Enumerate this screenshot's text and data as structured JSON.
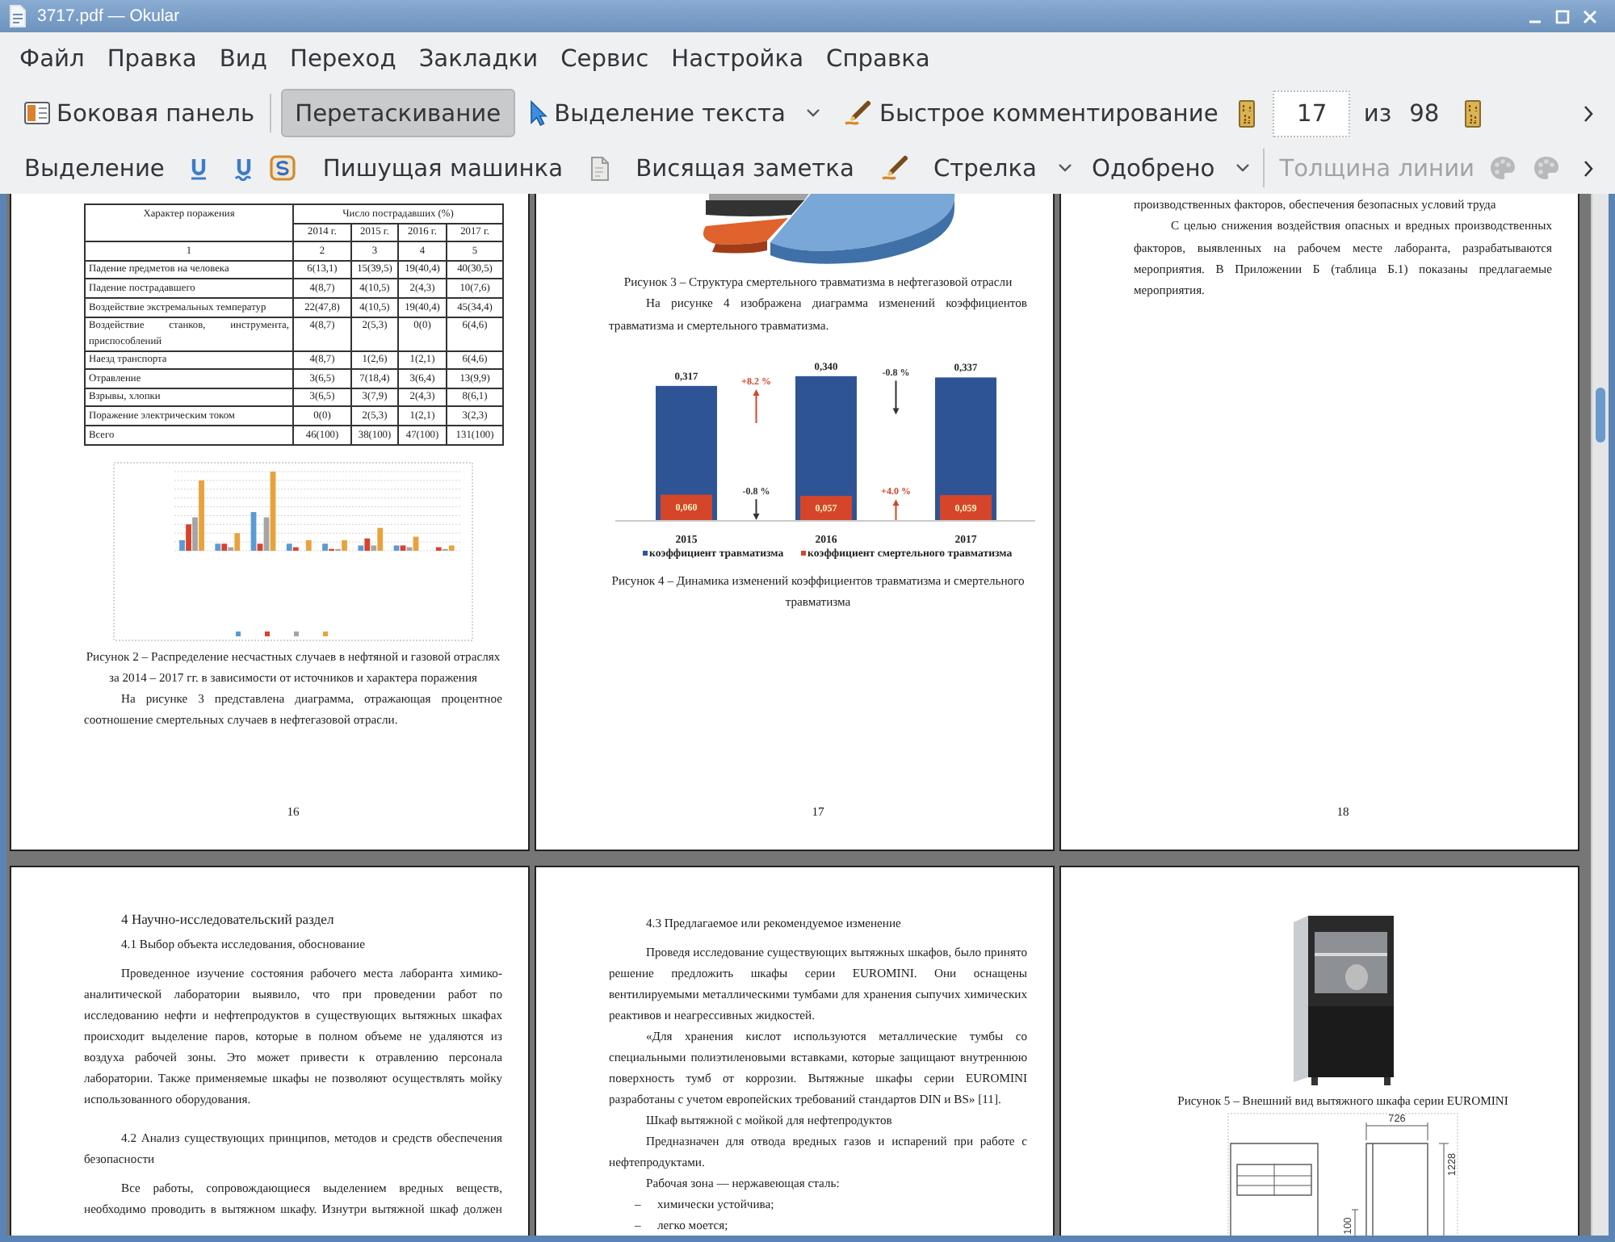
{
  "window": {
    "title": "3717.pdf — Okular"
  },
  "menu": [
    "Файл",
    "Правка",
    "Вид",
    "Переход",
    "Закладки",
    "Сервис",
    "Настройка",
    "Справка"
  ],
  "main_toolbar": {
    "sidebar": "Боковая панель",
    "modes": [
      {
        "label": "Перетаскивание",
        "selected": true
      },
      {
        "label": "Выделение текста",
        "selected": false
      }
    ],
    "quick_annotations": "Быстрое комментирование",
    "page_field": {
      "value": "17"
    },
    "page_of": "из",
    "page_count": "98"
  },
  "annotation_toolbar": {
    "highlighter": "Выделение",
    "typewriter": "Пишущая машинка",
    "popup_note": "Висящая заметка",
    "shapes": "Стрелка",
    "stamp": "Одобрено",
    "line_width": {
      "label": "Толщина линии",
      "disabled": true
    },
    "trailing_tools": [
      {
        "disabled": true
      },
      {
        "disabled": true
      }
    ]
  },
  "document": {
    "pages": [
      {
        "number": "16",
        "blocks": [
          {
            "kind": "table",
            "header": {
              "label_column": "Характер поражения",
              "group": "Число пострадавших (%)",
              "years": [
                "2014 г.",
                "2015 г.",
                "2016 г.",
                "2017 г."
              ]
            },
            "numbering": [
              "1",
              "2",
              "3",
              "4",
              "5"
            ],
            "rows": [
              [
                "Падение предметов на человека",
                "6(13,1)",
                "15(39,5)",
                "19(40,4)",
                "40(30,5)"
              ],
              [
                "Падение пострадавшего",
                "4(8,7)",
                "4(10,5)",
                "2(4,3)",
                "10(7,6)"
              ],
              [
                "Воздействие экстремальных температур",
                "22(47,8)",
                "4(10,5)",
                "19(40,4)",
                "45(34,4)"
              ],
              [
                "Воздействие станков, инструмента, приспособлений",
                "4(8,7)",
                "2(5,3)",
                "0(0)",
                "6(4,6)"
              ],
              [
                "Наезд транспорта",
                "4(8,7)",
                "1(2,6)",
                "1(2,1)",
                "6(4,6)"
              ],
              [
                "Отравление",
                "3(6,5)",
                "7(18,4)",
                "3(6,4)",
                "13(9,9)"
              ],
              [
                "Взрывы, хлопки",
                "3(6,5)",
                "3(7,9)",
                "2(4,3)",
                "8(6,1)"
              ],
              [
                "Поражение электрическим током",
                "0(0)",
                "2(5,3)",
                "1(2,1)",
                "3(2,3)"
              ],
              [
                "Всего",
                "46(100)",
                "38(100)",
                "47(100)",
                "131(100)"
              ]
            ]
          },
          {
            "kind": "bar_chart_picture"
          },
          {
            "kind": "caption",
            "text": "Рисунок 2 – Распределение несчастных случаев в нефтяной и газовой отраслях за 2014 – 2017 гг. в зависимости от источников и характера поражения"
          },
          {
            "kind": "paragraph",
            "text": "На рисунке 3 представлена диаграмма, отражающая процентное соотношение смертельных случаев в нефтегазовой отрасли."
          }
        ]
      },
      {
        "number": "17",
        "blocks": [
          {
            "kind": "pie_picture"
          },
          {
            "kind": "caption",
            "text": "Рисунок 3 – Структура смертельного травматизма в нефтегазовой отрасли"
          },
          {
            "kind": "paragraph",
            "text": "На рисунке 4 изображена диаграмма изменений коэффициентов травматизма и смертельного травматизма."
          },
          {
            "kind": "bar_chart",
            "chart_data": {
              "type": "bar",
              "categories": [
                "2015",
                "2016",
                "2017"
              ],
              "series": [
                {
                  "name": "коэффициент травматизма",
                  "color": "#2f5496",
                  "values": [
                    0.317,
                    0.34,
                    0.337
                  ],
                  "value_labels": [
                    "0,317",
                    "0,340",
                    "0,337"
                  ]
                },
                {
                  "name": "коэффициент смертельного травматизма",
                  "color": "#d5452a",
                  "values": [
                    0.06,
                    0.057,
                    0.059
                  ],
                  "value_labels": [
                    "0,060",
                    "0,057",
                    "0,059"
                  ]
                }
              ],
              "data_labels": true,
              "legend": "bottom",
              "annotations": [
                "+8.2 %",
                "-0.8 %",
                "-0.8 %",
                "+4.0 %"
              ]
            }
          },
          {
            "kind": "caption",
            "text": "Рисунок 4 – Динамика изменений коэффициентов травматизма и смертельного травматизма"
          }
        ]
      },
      {
        "number": "18",
        "blocks": [
          {
            "kind": "continuation",
            "text": "производственных факторов, обеспечения безопасных условий труда"
          },
          {
            "kind": "paragraph",
            "text": "С целью снижения воздействия опасных и вредных производственных факторов, выявленных на рабочем месте лаборанта, разрабатываются мероприятия. В Приложении Б (таблица Б.1) показаны предлагаемые мероприятия."
          }
        ]
      },
      {
        "blocks": [
          {
            "kind": "heading",
            "text": "4 Научно-исследовательский раздел"
          },
          {
            "kind": "subheading",
            "text": "4.1 Выбор объекта исследования, обоснование"
          },
          {
            "kind": "paragraph",
            "text": "Проведенное изучение состояния рабочего места лаборанта химико-аналитической лаборатории выявило, что при проведении работ по исследованию нефти и нефтепродуктов в существующих вытяжных шкафах происходит выделение паров, которые в полном объеме не удаляются из воздуха рабочей зоны. Это может привести к отравлению персонала лаборатории. Также применяемые шкафы не позволяют осуществлять мойку использованного оборудования."
          },
          {
            "kind": "subheading",
            "text": "4.2 Анализ существующих принципов, методов и средств обеспечения безопасности"
          },
          {
            "kind": "paragraph",
            "continues": true,
            "text": "Все работы, сопровождающиеся выделением вредных веществ, необходимо проводить в вытяжном шкафу. Изнутри вытяжной шкаф должен"
          }
        ]
      },
      {
        "blocks": [
          {
            "kind": "subheading",
            "text": "4.3 Предлагаемое или рекомендуемое изменение"
          },
          {
            "kind": "paragraph",
            "text": "Проведя исследование существующих вытяжных шкафов, было принято решение предложить шкафы серии EUROMINI. Они оснащены вентилируемыми металлическими тумбами для хранения сыпучих химических реактивов и неагрессивных жидкостей."
          },
          {
            "kind": "paragraph",
            "text": "«Для хранения кислот используются металлические тумбы со специальными полиэтиленовыми вставками, которые защищают внутреннюю поверхность тумб от коррозии. Вытяжные шкафы серии EUROMINI разработаны с учетом европейских требований стандартов DIN и BS» [11]."
          },
          {
            "kind": "paragraph",
            "text": "Шкаф вытяжной с мойкой для нефтепродуктов"
          },
          {
            "kind": "paragraph",
            "text": "Предназначен для отвода вредных газов и испарений при работе с нефтепродуктами."
          },
          {
            "kind": "paragraph",
            "text": "Рабочая зона — нержавеющая сталь:"
          },
          {
            "kind": "list_item",
            "marker": "–",
            "text": "химически устойчива;"
          },
          {
            "kind": "list_item",
            "marker": "–",
            "text": "легко моется;"
          }
        ]
      },
      {
        "blocks": [
          {
            "kind": "photo"
          },
          {
            "kind": "caption",
            "text": "Рисунок 5 – Внешний вид вытяжного шкафа серии EUROMINI"
          },
          {
            "kind": "blueprint",
            "dimension_labels": [
              "726",
              "1228",
              "100"
            ]
          }
        ]
      }
    ]
  }
}
